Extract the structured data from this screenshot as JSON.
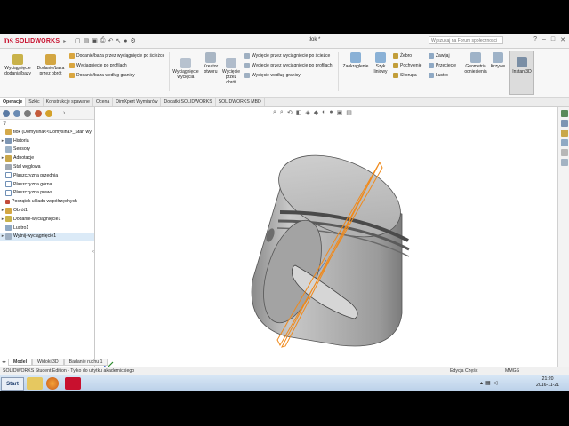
{
  "app": {
    "brand": "SOLIDWORKS",
    "doc_title": "tłok *",
    "search_placeholder": "Wyszukaj na Forum społeczności"
  },
  "ribbon": {
    "extrude_boss": "Wyciągnięcie dodania/bazy",
    "revolve_boss": "Dodanie/baza przez obrót",
    "sweep_boss": "Dodanie/baza przez wyciągnięcie po ścieżce",
    "loft_boss": "Wyciągnięcie po profilach",
    "boundary_boss": "Dodanie/baza według granicy",
    "extruded_cut": "Wyciągnięcie wycięcia",
    "hole_wizard": "Kreator otworu",
    "revolved_cut": "Wycięcie przez obrót",
    "swept_cut": "Wycięcie przez wyciągnięcie po ścieżce",
    "lofted_cut": "Wycięcie przez wyciągnięcie po profilach",
    "boundary_cut": "Wycięcie według granicy",
    "fillet": "Zaokrąglenie",
    "linear_pattern": "Szyk liniowy",
    "rib": "Żebro",
    "draft": "Pochylenie",
    "shell": "Skorupa",
    "wrap": "Zawijaj",
    "intersect": "Przecięcie",
    "mirror": "Lustro",
    "ref_geometry": "Geometria odniesienia",
    "curves": "Krzywe",
    "instant3d": "Instant3D"
  },
  "tabs": [
    "Operacje",
    "Szkic",
    "Konstrukcje spawane",
    "Ocena",
    "DimXpert Wymiarów",
    "Dodatki SOLIDWORKS",
    "SOLIDWORKS MBD"
  ],
  "tree": {
    "root": "tłok (Domyślna<<Domyślna>_Stan wy",
    "items": [
      "Historia",
      "Sensory",
      "Adnotacje",
      "Stal węglowa",
      "Płaszczyzna przednia",
      "Płaszczyzna górna",
      "Płaszczyzna prawa",
      "Początek układu współrzędnych",
      "Obrót1",
      "Dodanie-wyciągnięcie1",
      "Lustro1",
      "Wytnij-wyciągnięcie1"
    ]
  },
  "bottom_tabs": [
    "Model",
    "Widoki 3D",
    "Badanie ruchu 1"
  ],
  "status": {
    "left": "SOLIDWORKS Student Edition - Tylko do użytku akademickiego",
    "mode": "Edycja Część",
    "units": "MMGS"
  },
  "taskbar": {
    "start": "Start",
    "time": "21:20",
    "date": "2016-11-21"
  },
  "colors": {
    "brand_red": "#c8102e",
    "plane_orange": "#f08a1c",
    "selection_blue": "#2b6fd6"
  }
}
